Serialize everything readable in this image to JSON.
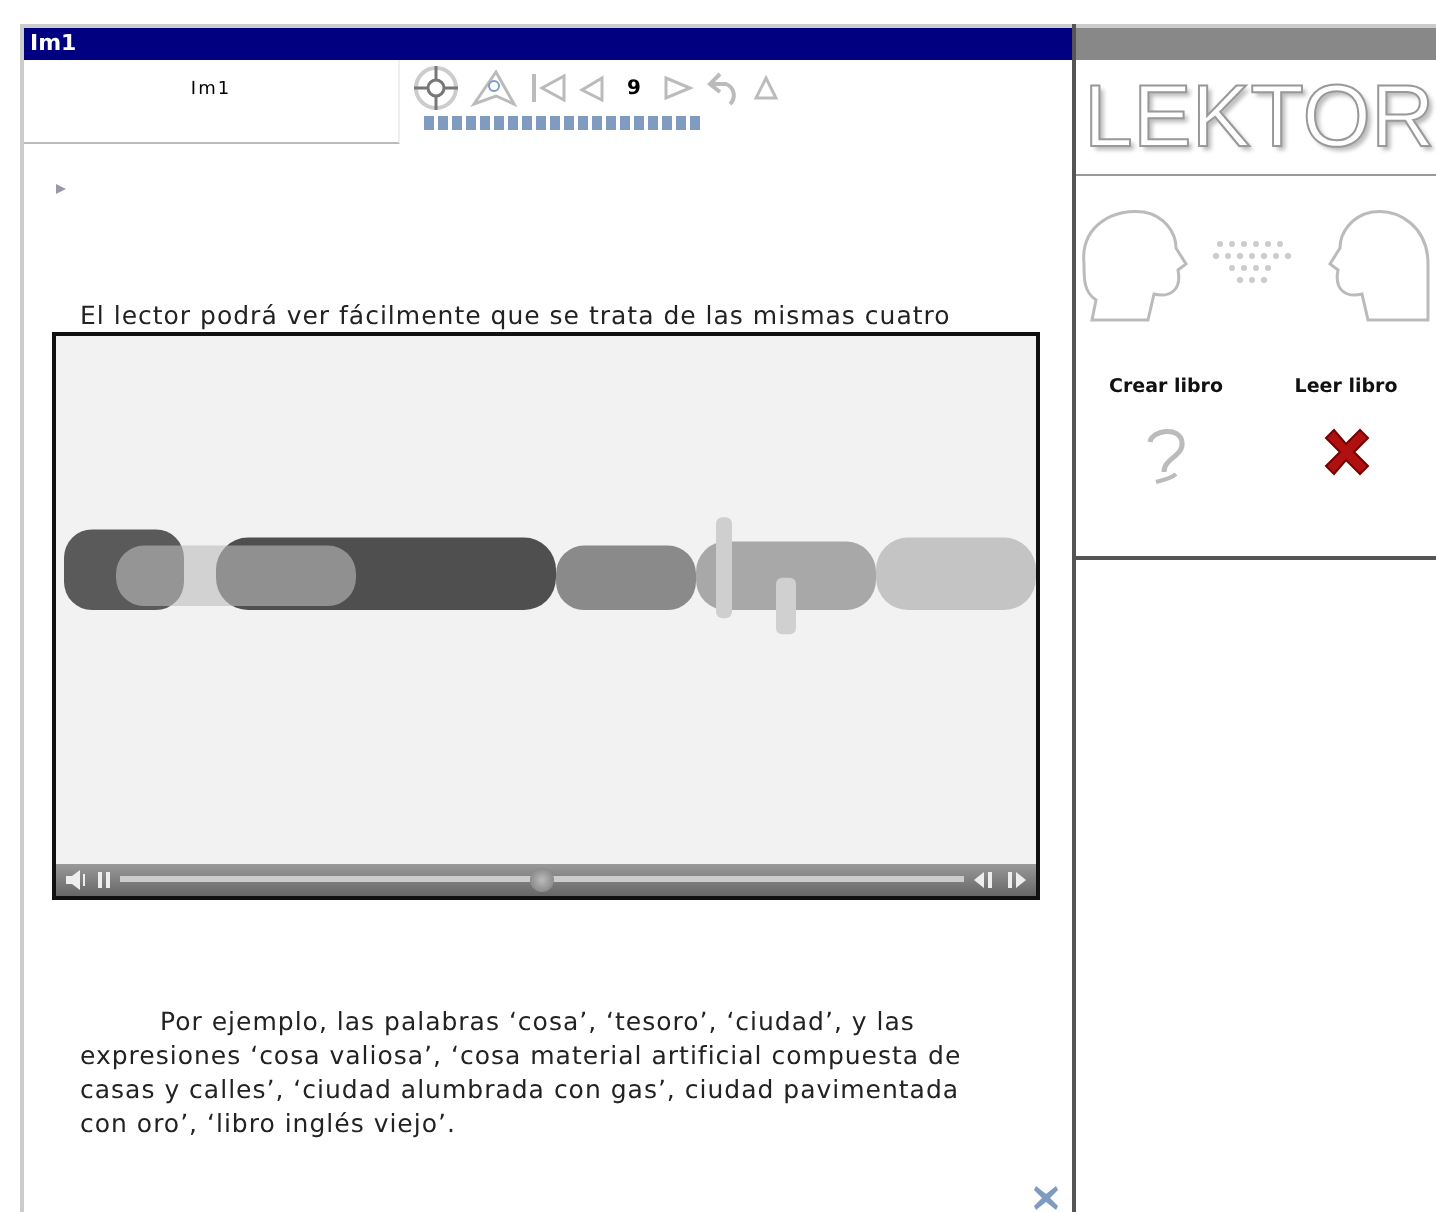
{
  "window": {
    "title": "Im1"
  },
  "toolbar": {
    "cell_label": "Im1",
    "page_number": "9",
    "progress": {
      "level": 1
    }
  },
  "content": {
    "paragraphs": [
      "El lector podrá ver fácilmente que se trata de las mismas cuatro",
      "Por ejemplo, las palabras ‘cosa’, ‘tesoro’, ‘ciudad’, y las expresiones ‘cosa valiosa’, ‘cosa material artificial compuesta de casas y calles’, ‘ciudad alumbrada con gas’, ciudad pavimentada con oro’, ‘libro inglés viejo’."
    ]
  },
  "video": {
    "level": 0.5
  },
  "side_panel": {
    "logo": "LEKTOR",
    "actions": [
      {
        "label": "Crear libro",
        "kind": "help"
      },
      {
        "label": "Leer libro",
        "kind": "close"
      }
    ]
  }
}
